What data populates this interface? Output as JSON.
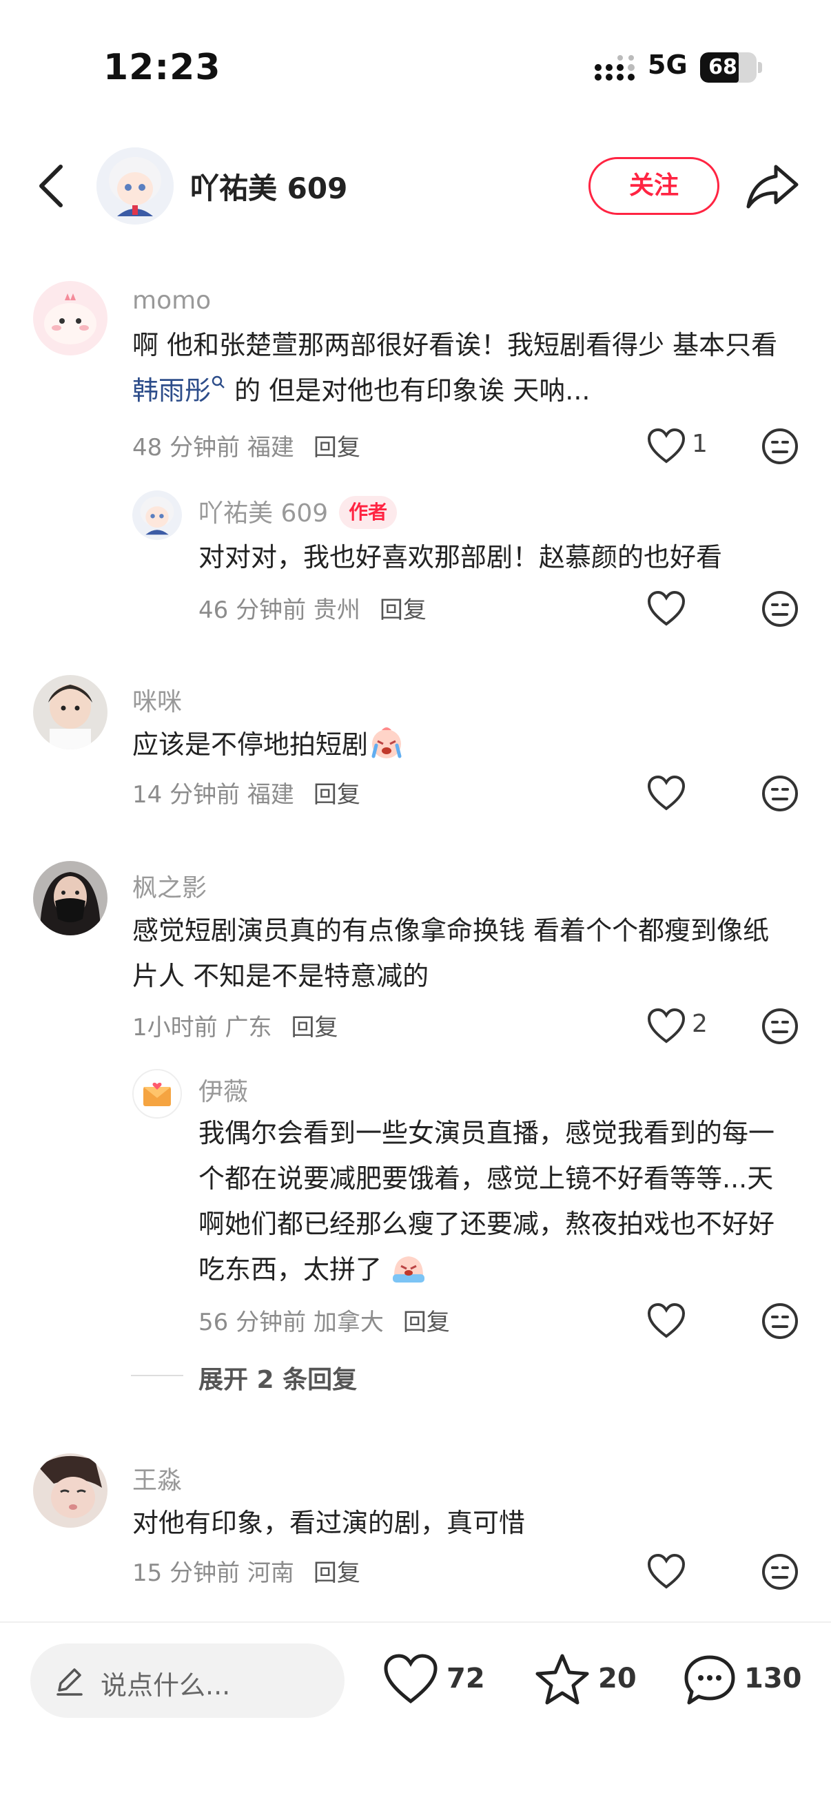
{
  "status_bar": {
    "time": "12:23",
    "network": "5G",
    "battery": "68",
    "battery_level": 0.68
  },
  "header": {
    "username": "吖祐美 609",
    "follow_label": "关注"
  },
  "comments": [
    {
      "name": "momo",
      "text_before": "啊 他和张楚萱那两部很好看诶！我短剧看得少 基本只看 ",
      "mention": "韩雨彤",
      "text_after": " 的 但是对他也有印象诶 天呐...",
      "meta": "48 分钟前  福建",
      "reply": "回复",
      "likes": "1"
    },
    {
      "name": "吖祐美 609",
      "author_tag": "作者",
      "text": "对对对，我也好喜欢那部剧！赵慕颜的也好看",
      "meta": "46 分钟前  贵州",
      "reply": "回复",
      "likes": ""
    },
    {
      "name": "咪咪",
      "text": "应该是不停地拍短剧",
      "meta": "14 分钟前  福建",
      "reply": "回复",
      "likes": ""
    },
    {
      "name": "枫之影",
      "text": "感觉短剧演员真的有点像拿命换钱 看着个个都瘦到像纸片人 不知是不是特意减的",
      "meta": "1小时前  广东",
      "reply": "回复",
      "likes": "2"
    },
    {
      "name": "伊薇",
      "text": "我偶尔会看到一些女演员直播，感觉我看到的每一个都在说要减肥要饿着，感觉上镜不好看等等...天啊她们都已经那么瘦了还要减，熬夜拍戏也不好好吃东西，太拼了 ",
      "meta": "56 分钟前  加拿大",
      "reply": "回复",
      "likes": ""
    },
    {
      "name": "王淼",
      "text": "对他有印象，看过演的剧，真可惜",
      "meta": "15 分钟前  河南",
      "reply": "回复",
      "likes": ""
    }
  ],
  "expand_replies": "展开 2 条回复",
  "bottom_bar": {
    "input_placeholder": "说点什么...",
    "likes": "72",
    "favorites": "20",
    "comments": "130"
  },
  "colors": {
    "accent": "#ff2442",
    "mention": "#2d4d8a",
    "meta": "#8c8c8c"
  }
}
